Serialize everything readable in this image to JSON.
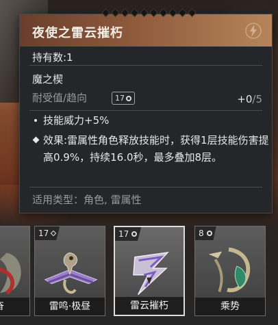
{
  "tooltip": {
    "title": "夜使之雷云摧朽",
    "owned": "持有数:1",
    "owner": "魔之楔",
    "durability_label": "耐受值/趋向",
    "level": "17",
    "progress_current": "+0",
    "progress_max": "/5",
    "stat": "技能威力+5%",
    "effect": "效果:雷属性角色释放技能时，获得1层技能伤害提高0.9%，持续16.0秒，最多叠加8层。",
    "applicable": "适用类型：角色, 雷属性"
  },
  "cards": [
    {
      "name": "振奋",
      "level": ""
    },
    {
      "name": "雷鸣·极昼",
      "level": "17"
    },
    {
      "name": "雷云摧朽",
      "level": "17"
    },
    {
      "name": "乘势",
      "level": "8"
    }
  ]
}
